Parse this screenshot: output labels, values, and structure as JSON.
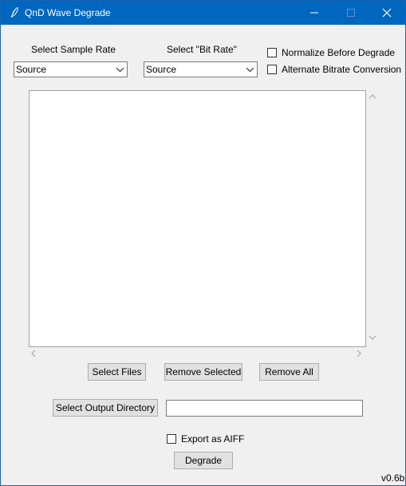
{
  "window": {
    "title": "QnD Wave Degrade",
    "colors": {
      "titlebar": "#0067c0",
      "background": "#f0f0f0"
    }
  },
  "sample_rate": {
    "label": "Select Sample Rate",
    "selected": "Source"
  },
  "bit_rate": {
    "label": "Select \"Bit Rate\"",
    "selected": "Source"
  },
  "options": {
    "normalize_label": "Normalize Before Degrade",
    "normalize_checked": false,
    "alternate_label": "Alternate Bitrate Conversion",
    "alternate_checked": false
  },
  "file_list": {
    "items": []
  },
  "actions": {
    "select_files": "Select Files",
    "remove_selected": "Remove Selected",
    "remove_all": "Remove All"
  },
  "output": {
    "select_dir_label": "Select Output Directory",
    "path_value": ""
  },
  "export": {
    "aiff_label": "Export as AIFF",
    "aiff_checked": false
  },
  "degrade_label": "Degrade",
  "version": "v0.6b"
}
